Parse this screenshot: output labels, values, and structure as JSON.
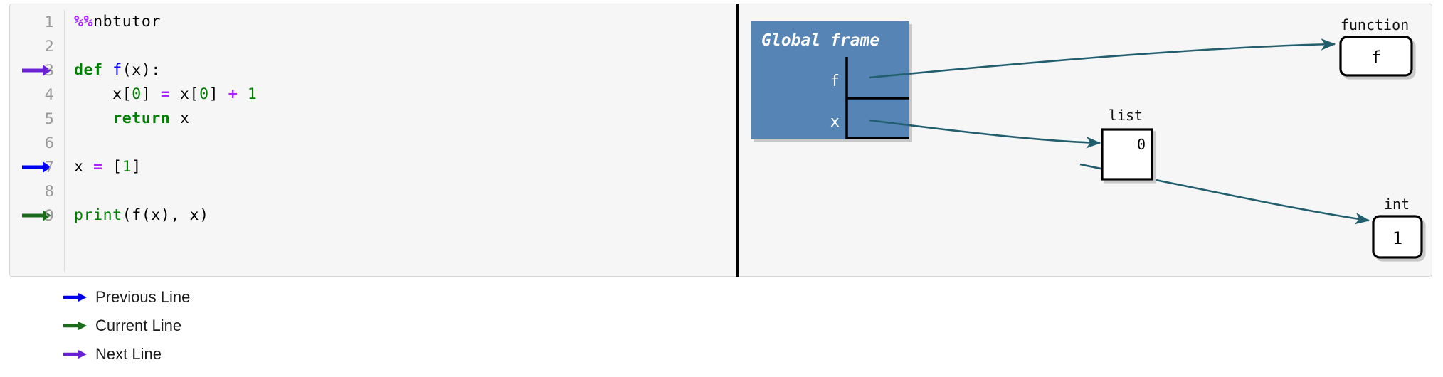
{
  "editor": {
    "lines": [
      {
        "number": "1",
        "marker": null,
        "tokens": [
          {
            "t": "%%",
            "c": "magic"
          },
          {
            "t": "nbtutor",
            "c": "plain"
          }
        ]
      },
      {
        "number": "2",
        "marker": null,
        "tokens": []
      },
      {
        "number": "3",
        "marker": "next",
        "tokens": [
          {
            "t": "def ",
            "c": "kw"
          },
          {
            "t": "f",
            "c": "func"
          },
          {
            "t": "(x):",
            "c": "plain"
          }
        ]
      },
      {
        "number": "4",
        "marker": null,
        "tokens": [
          {
            "t": "    x[",
            "c": "plain"
          },
          {
            "t": "0",
            "c": "num"
          },
          {
            "t": "] ",
            "c": "plain"
          },
          {
            "t": "=",
            "c": "op"
          },
          {
            "t": " x[",
            "c": "plain"
          },
          {
            "t": "0",
            "c": "num"
          },
          {
            "t": "] ",
            "c": "plain"
          },
          {
            "t": "+",
            "c": "op"
          },
          {
            "t": " ",
            "c": "plain"
          },
          {
            "t": "1",
            "c": "num"
          }
        ]
      },
      {
        "number": "5",
        "marker": null,
        "tokens": [
          {
            "t": "    ",
            "c": "plain"
          },
          {
            "t": "return",
            "c": "kw"
          },
          {
            "t": " x",
            "c": "plain"
          }
        ]
      },
      {
        "number": "6",
        "marker": null,
        "tokens": []
      },
      {
        "number": "7",
        "marker": "previous",
        "tokens": [
          {
            "t": "x ",
            "c": "plain"
          },
          {
            "t": "=",
            "c": "op"
          },
          {
            "t": " [",
            "c": "plain"
          },
          {
            "t": "1",
            "c": "num"
          },
          {
            "t": "]",
            "c": "plain"
          }
        ]
      },
      {
        "number": "8",
        "marker": null,
        "tokens": []
      },
      {
        "number": "9",
        "marker": "current",
        "tokens": [
          {
            "t": "print",
            "c": "builtin"
          },
          {
            "t": "(f(x), x)",
            "c": "plain"
          }
        ]
      }
    ]
  },
  "diagram": {
    "frame": {
      "title": "Global frame",
      "rows": [
        {
          "name": "f",
          "value": ""
        },
        {
          "name": "x",
          "value": ""
        }
      ]
    },
    "objects": [
      {
        "type_label": "function",
        "value": "f",
        "shape": "rounded"
      },
      {
        "type_label": "list",
        "value": "0",
        "shape": "square"
      },
      {
        "type_label": "int",
        "value": "1",
        "shape": "rounded"
      }
    ]
  },
  "legend": {
    "items": [
      {
        "label": "Previous Line",
        "color": "#0000ee",
        "icon": "arrow-right-icon"
      },
      {
        "label": "Current Line",
        "color": "#1a6b1a",
        "icon": "arrow-right-icon"
      },
      {
        "label": "Next Line",
        "color": "#6a21d6",
        "icon": "arrow-right-icon"
      }
    ]
  },
  "colors": {
    "frame_fill": "#5484b5",
    "frame_text": "#ffffff",
    "arrow": "#225f6e",
    "divider": "#000000",
    "panel_bg": "#f6f6f6",
    "lineno": "#9a9a9a",
    "marker_previous": "#0000ee",
    "marker_current": "#1a6b1a",
    "marker_next": "#6a21d6"
  }
}
